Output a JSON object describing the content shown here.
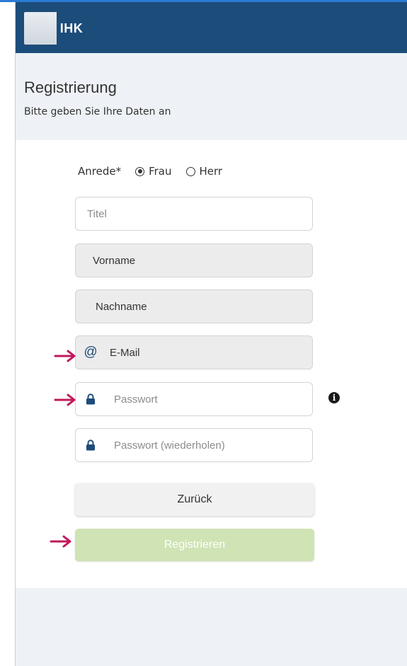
{
  "header": {
    "logo_text": "IHK"
  },
  "page": {
    "title": "Registrierung",
    "subtitle": "Bitte geben Sie Ihre Daten an"
  },
  "form": {
    "salutation_label": "Anrede*",
    "salutation_options": [
      {
        "label": "Frau",
        "selected": true
      },
      {
        "label": "Herr",
        "selected": false
      }
    ],
    "title_placeholder": "Titel",
    "firstname_value": "Vorname",
    "lastname_value": "Nachname",
    "email_value": "E-Mail",
    "password_placeholder": "Passwort",
    "password_repeat_placeholder": "Passwort (wiederholen)",
    "back_label": "Zurück",
    "register_label": "Registrieren"
  },
  "colors": {
    "header_bg": "#1c4c7a",
    "register_button": "#cfe3b4",
    "annotation_arrow": "#c2185b"
  },
  "icons": {
    "email": "at-icon",
    "password": "lock-icon",
    "info": "info-icon",
    "arrow": "arrow-right-icon"
  }
}
